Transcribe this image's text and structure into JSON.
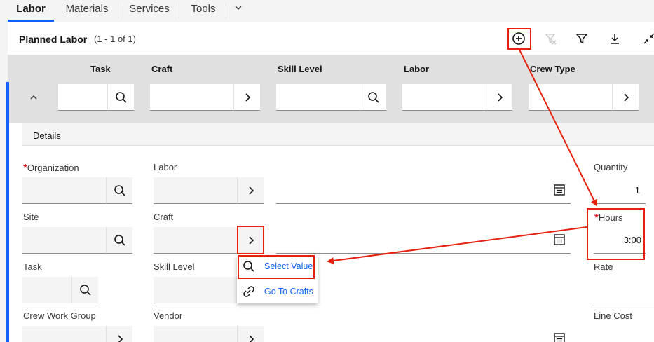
{
  "tabs": [
    {
      "label": "Labor",
      "active": true
    },
    {
      "label": "Materials",
      "active": false
    },
    {
      "label": "Services",
      "active": false
    },
    {
      "label": "Tools",
      "active": false
    }
  ],
  "header": {
    "title": "Planned Labor",
    "count": "(1 - 1 of 1)",
    "icons": [
      "add-icon",
      "clear-filter-icon",
      "filter-icon",
      "download-icon",
      "collapse-icon"
    ]
  },
  "columns": {
    "task": "Task",
    "craft": "Craft",
    "skill_level": "Skill Level",
    "labor": "Labor",
    "crew_type": "Crew Type"
  },
  "details": {
    "section_label": "Details",
    "organization": {
      "label": "Organization",
      "value": "",
      "required": true
    },
    "labor": {
      "label": "Labor",
      "value": ""
    },
    "quantity": {
      "label": "Quantity",
      "value": "1"
    },
    "site": {
      "label": "Site",
      "value": ""
    },
    "craft": {
      "label": "Craft",
      "value": ""
    },
    "hours": {
      "label": "Hours",
      "value": "3:00",
      "required": true
    },
    "task": {
      "label": "Task",
      "value": ""
    },
    "skill_level": {
      "label": "Skill Level",
      "value": ""
    },
    "rate": {
      "label": "Rate",
      "value": ""
    },
    "crew_work_group": {
      "label": "Crew Work Group",
      "value": ""
    },
    "vendor": {
      "label": "Vendor",
      "value": ""
    },
    "line_cost": {
      "label": "Line Cost",
      "value": ""
    },
    "required_mark": "*"
  },
  "popup_menu": {
    "items": [
      {
        "label": "Select Value",
        "icon": "search-icon"
      },
      {
        "label": "Go To Crafts",
        "icon": "link-icon"
      }
    ]
  },
  "colors": {
    "accent": "#0f62fe",
    "annotation_red": "#e8210f",
    "required_red": "#da1e28"
  }
}
